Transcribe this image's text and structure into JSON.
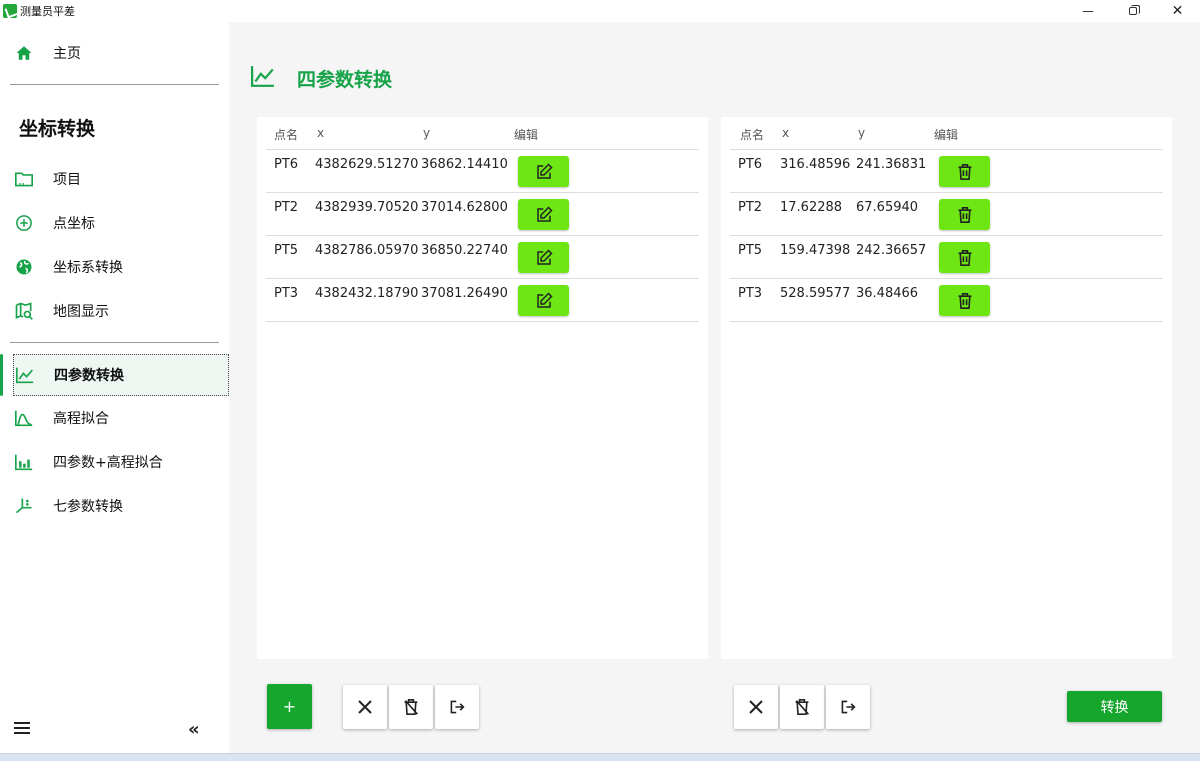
{
  "window": {
    "title": "测量员平差",
    "controls": {
      "minimize": "minimize",
      "restore": "restore",
      "close": "✕"
    }
  },
  "sidebar": {
    "home_label": "主页",
    "section_title": "坐标转换",
    "items": [
      {
        "label": "项目",
        "icon": "folder-icon"
      },
      {
        "label": "点坐标",
        "icon": "plus-circle-icon"
      },
      {
        "label": "坐标系转换",
        "icon": "globe-icon"
      },
      {
        "label": "地图显示",
        "icon": "map-search-icon"
      },
      {
        "label": "四参数转换",
        "icon": "line-chart-icon",
        "active": true
      },
      {
        "label": "高程拟合",
        "icon": "area-chart-icon"
      },
      {
        "label": "四参数+高程拟合",
        "icon": "bar-chart-icon"
      },
      {
        "label": "七参数转换",
        "icon": "axes-icon"
      }
    ],
    "collapse_glyph": "«"
  },
  "page": {
    "title": "四参数转换"
  },
  "left_table": {
    "headers": {
      "name": "点名",
      "x": "x",
      "y": "y",
      "edit": "编辑"
    },
    "rows": [
      {
        "name": "PT6",
        "x": "4382629.51270",
        "y": "36862.14410"
      },
      {
        "name": "PT2",
        "x": "4382939.70520",
        "y": "37014.62800"
      },
      {
        "name": "PT5",
        "x": "4382786.05970",
        "y": "36850.22740"
      },
      {
        "name": "PT3",
        "x": "4382432.18790",
        "y": "37081.26490"
      }
    ]
  },
  "right_table": {
    "headers": {
      "name": "点名",
      "x": "x",
      "y": "y",
      "edit": "编辑"
    },
    "rows": [
      {
        "name": "PT6",
        "x": "316.48596",
        "y": "241.36831"
      },
      {
        "name": "PT2",
        "x": "17.62288",
        "y": "67.65940"
      },
      {
        "name": "PT5",
        "x": "159.47398",
        "y": "242.36657"
      },
      {
        "name": "PT3",
        "x": "528.59577",
        "y": "36.48466"
      }
    ]
  },
  "toolbar": {
    "add_label": "+",
    "convert_label": "转换"
  },
  "colors": {
    "accent": "#17a34a",
    "button_green": "#16a62e",
    "row_button": "#6ee614"
  }
}
